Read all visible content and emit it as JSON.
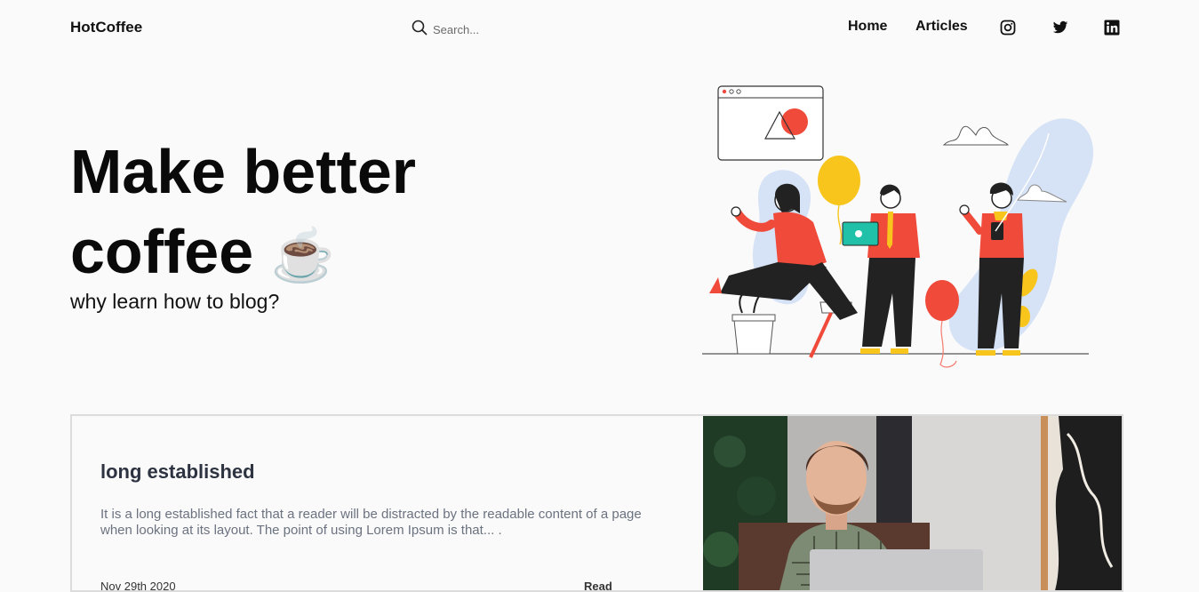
{
  "header": {
    "brand": "HotCoffee",
    "search": {
      "placeholder": "Search..."
    },
    "nav": [
      {
        "label": "Home"
      },
      {
        "label": "Articles"
      }
    ],
    "social_icons": [
      "instagram-icon",
      "twitter-icon",
      "linkedin-icon"
    ]
  },
  "hero": {
    "title_line1": "Make better",
    "title_line2": "coffee",
    "title_emoji": "☕",
    "subtitle": "why learn how to blog?"
  },
  "article": {
    "title": "long established",
    "excerpt": "It is a long established fact that a reader will be distracted by the readable content of a page when looking at its layout. The point of using Lorem Ipsum is that... .",
    "date": "Nov 29th 2020",
    "read_label": "Read"
  },
  "colors": {
    "accent_red": "#f04a3a",
    "accent_yellow": "#f8c51c",
    "blob_blue": "#d6e2f5",
    "teal": "#21c0a8"
  }
}
